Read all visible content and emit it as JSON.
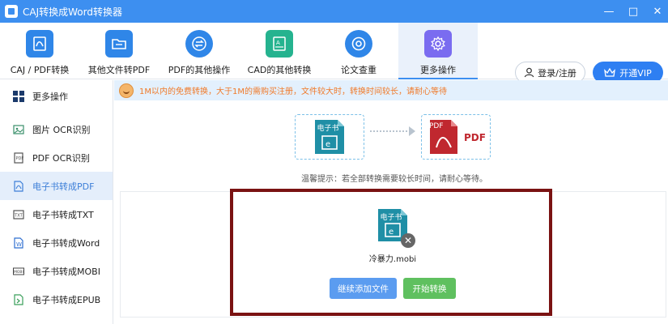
{
  "window": {
    "title": "CAJ转换成Word转换器",
    "controls": [
      "—",
      "□",
      "✕"
    ]
  },
  "toolbar": {
    "tools": [
      {
        "label": "CAJ / PDF转换",
        "icon": "pdf-convert-icon",
        "color": "#2f86e8"
      },
      {
        "label": "其他文件转PDF",
        "icon": "folder-icon",
        "color": "#2f86e8"
      },
      {
        "label": "PDF的其他操作",
        "icon": "swap-icon",
        "color": "#2f86e8"
      },
      {
        "label": "CAD的其他转换",
        "icon": "cad-icon",
        "color": "#25b38f"
      },
      {
        "label": "论文查重",
        "icon": "at-icon",
        "color": "#2f86e8"
      },
      {
        "label": "更多操作",
        "icon": "gear-icon",
        "color": "#7a6cf0"
      }
    ],
    "active_index": 5,
    "login_label": "登录/注册",
    "vip_label": "开通VIP"
  },
  "sidebar": {
    "header": "更多操作",
    "items": [
      {
        "label": "图片 OCR识别",
        "icon": "image-ocr-icon"
      },
      {
        "label": "PDF OCR识别",
        "icon": "pdf-ocr-icon"
      },
      {
        "label": "电子书转成PDF",
        "icon": "pdf-file-icon"
      },
      {
        "label": "电子书转成TXT",
        "icon": "txt-file-icon"
      },
      {
        "label": "电子书转成Word",
        "icon": "word-file-icon"
      },
      {
        "label": "电子书转成MOBI",
        "icon": "mobi-file-icon"
      },
      {
        "label": "电子书转成EPUB",
        "icon": "epub-file-icon"
      }
    ],
    "active_index": 2
  },
  "notice": {
    "text": "1M以内的免费转换，大于1M的需购买注册，文件较大时，转换时间较长，请耐心等待"
  },
  "conversion": {
    "source_label": "电子书",
    "target_label": "PDF",
    "target_badge": "PDF",
    "tip": "温馨提示：若全部转换需要较长时间，请耐心等待。"
  },
  "file": {
    "badge": "电子书",
    "name": "冷暴力.mobi"
  },
  "actions": {
    "add_label": "继续添加文件",
    "start_label": "开始转换"
  },
  "colors": {
    "accent": "#3d8ff0",
    "highlight_frame": "#7a1212",
    "start_button": "#5fc05f",
    "add_button": "#5b9cf0"
  }
}
